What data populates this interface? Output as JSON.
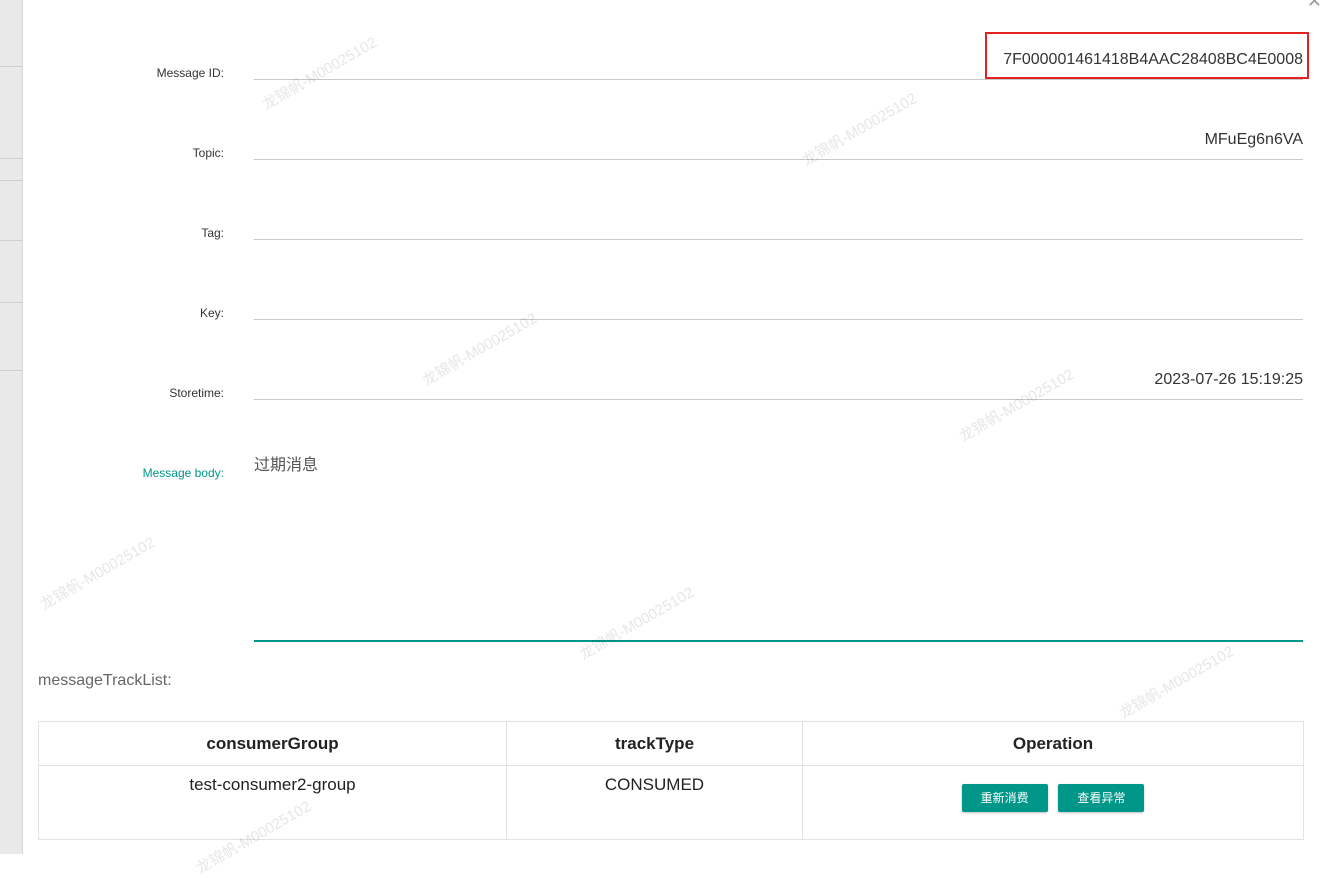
{
  "dialog": {
    "close_icon": "close-icon",
    "fields": {
      "message_id": {
        "label": "Message ID:",
        "value": "7F000001461418B4AAC28408BC4E0008"
      },
      "topic": {
        "label": "Topic:",
        "value": "MFuEg6n6VA"
      },
      "tag": {
        "label": "Tag:",
        "value": ""
      },
      "key": {
        "label": "Key:",
        "value": ""
      },
      "storetime": {
        "label": "Storetime:",
        "value": "2023-07-26 15:19:25"
      },
      "message_body": {
        "label": "Message body:",
        "value": "过期消息"
      }
    },
    "track_list": {
      "title": "messageTrackList:",
      "headers": {
        "consumer_group": "consumerGroup",
        "track_type": "trackType",
        "operation": "Operation"
      },
      "rows": [
        {
          "consumer_group": "test-consumer2-group",
          "track_type": "CONSUMED",
          "reconsume_label": "重新消费",
          "view_exception_label": "查看异常"
        }
      ]
    },
    "watermark_text": "龙锦帆-M00025102"
  },
  "colors": {
    "accent": "#009688",
    "highlight": "#e32222"
  }
}
